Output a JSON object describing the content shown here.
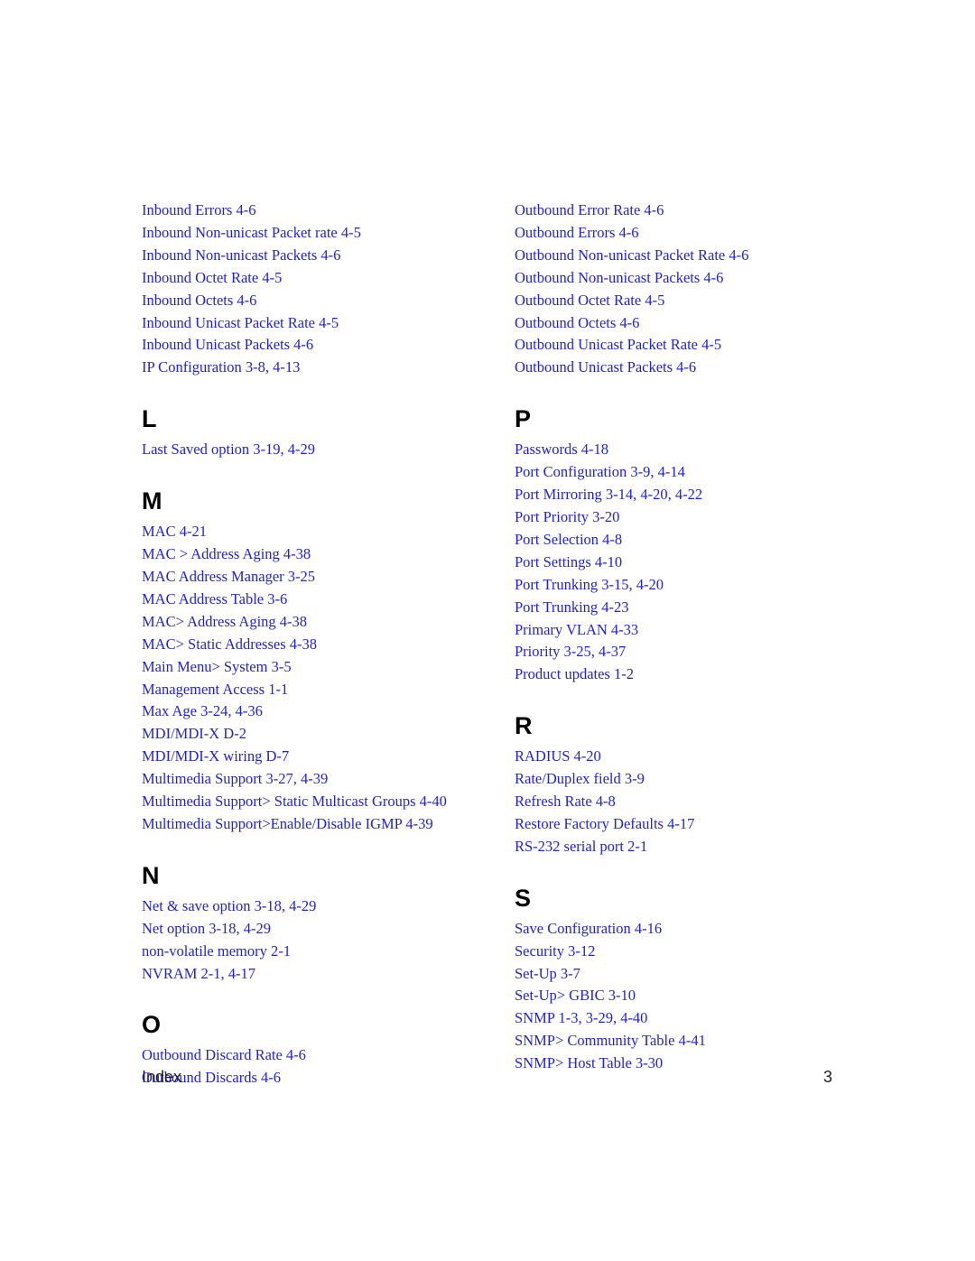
{
  "document": {
    "footer_label": "Index",
    "page_number": "3",
    "entry_color": "#2222dd",
    "heading_color": "#000000",
    "background_color": "#ffffff"
  },
  "columns": [
    {
      "name": "left-column",
      "sections": [
        {
          "heading": "",
          "entries": [
            "Inbound Errors  4-6",
            "Inbound Non-unicast Packet rate  4-5",
            "Inbound Non-unicast Packets  4-6",
            "Inbound Octet Rate  4-5",
            "Inbound Octets  4-6",
            "Inbound Unicast Packet Rate  4-5",
            "Inbound Unicast Packets  4-6",
            "IP Configuration  3-8, 4-13"
          ]
        },
        {
          "heading": "L",
          "entries": [
            "Last Saved option  3-19, 4-29"
          ]
        },
        {
          "heading": "M",
          "entries": [
            "MAC  4-21",
            "MAC > Address Aging  4-38",
            "MAC Address Manager  3-25",
            "MAC Address Table  3-6",
            "MAC> Address Aging  4-38",
            "MAC> Static Addresses  4-38",
            "Main Menu> System  3-5",
            "Management Access  1-1",
            "Max Age  3-24, 4-36",
            "MDI/MDI-X  D-2",
            "MDI/MDI-X wiring  D-7",
            "Multimedia Support  3-27, 4-39",
            "Multimedia Support> Static Multicast Groups  4-40",
            "Multimedia Support>Enable/Disable IGMP  4-39"
          ]
        },
        {
          "heading": "N",
          "entries": [
            "Net & save option  3-18, 4-29",
            "Net option  3-18, 4-29",
            "non-volatile memory  2-1",
            "NVRAM  2-1, 4-17"
          ]
        },
        {
          "heading": "O",
          "entries": [
            "Outbound Discard Rate  4-6",
            "Outbound Discards  4-6"
          ]
        }
      ]
    },
    {
      "name": "right-column",
      "sections": [
        {
          "heading": "",
          "entries": [
            "Outbound Error Rate  4-6",
            "Outbound Errors  4-6",
            "Outbound Non-unicast Packet Rate  4-6",
            "Outbound Non-unicast Packets  4-6",
            "Outbound Octet Rate  4-5",
            "Outbound Octets  4-6",
            "Outbound Unicast Packet Rate  4-5",
            "Outbound Unicast Packets  4-6"
          ]
        },
        {
          "heading": "P",
          "entries": [
            "Passwords  4-18",
            "Port Configuration  3-9, 4-14",
            "Port Mirroring  3-14, 4-20, 4-22",
            "Port Priority  3-20",
            "Port Selection  4-8",
            "Port Settings  4-10",
            "Port Trunking  3-15, 4-20",
            "Port Trunking  4-23",
            "Primary VLAN  4-33",
            "Priority  3-25, 4-37",
            "Product updates  1-2"
          ]
        },
        {
          "heading": "R",
          "entries": [
            "RADIUS  4-20",
            "Rate/Duplex field  3-9",
            "Refresh Rate  4-8",
            "Restore Factory Defaults  4-17",
            "RS-232 serial port  2-1"
          ]
        },
        {
          "heading": "S",
          "entries": [
            "Save Configuration  4-16",
            "Security  3-12",
            "Set-Up  3-7",
            "Set-Up> GBIC  3-10",
            "SNMP  1-3, 3-29, 4-40",
            "SNMP> Community Table  4-41",
            "SNMP> Host Table  3-30"
          ]
        }
      ]
    }
  ]
}
